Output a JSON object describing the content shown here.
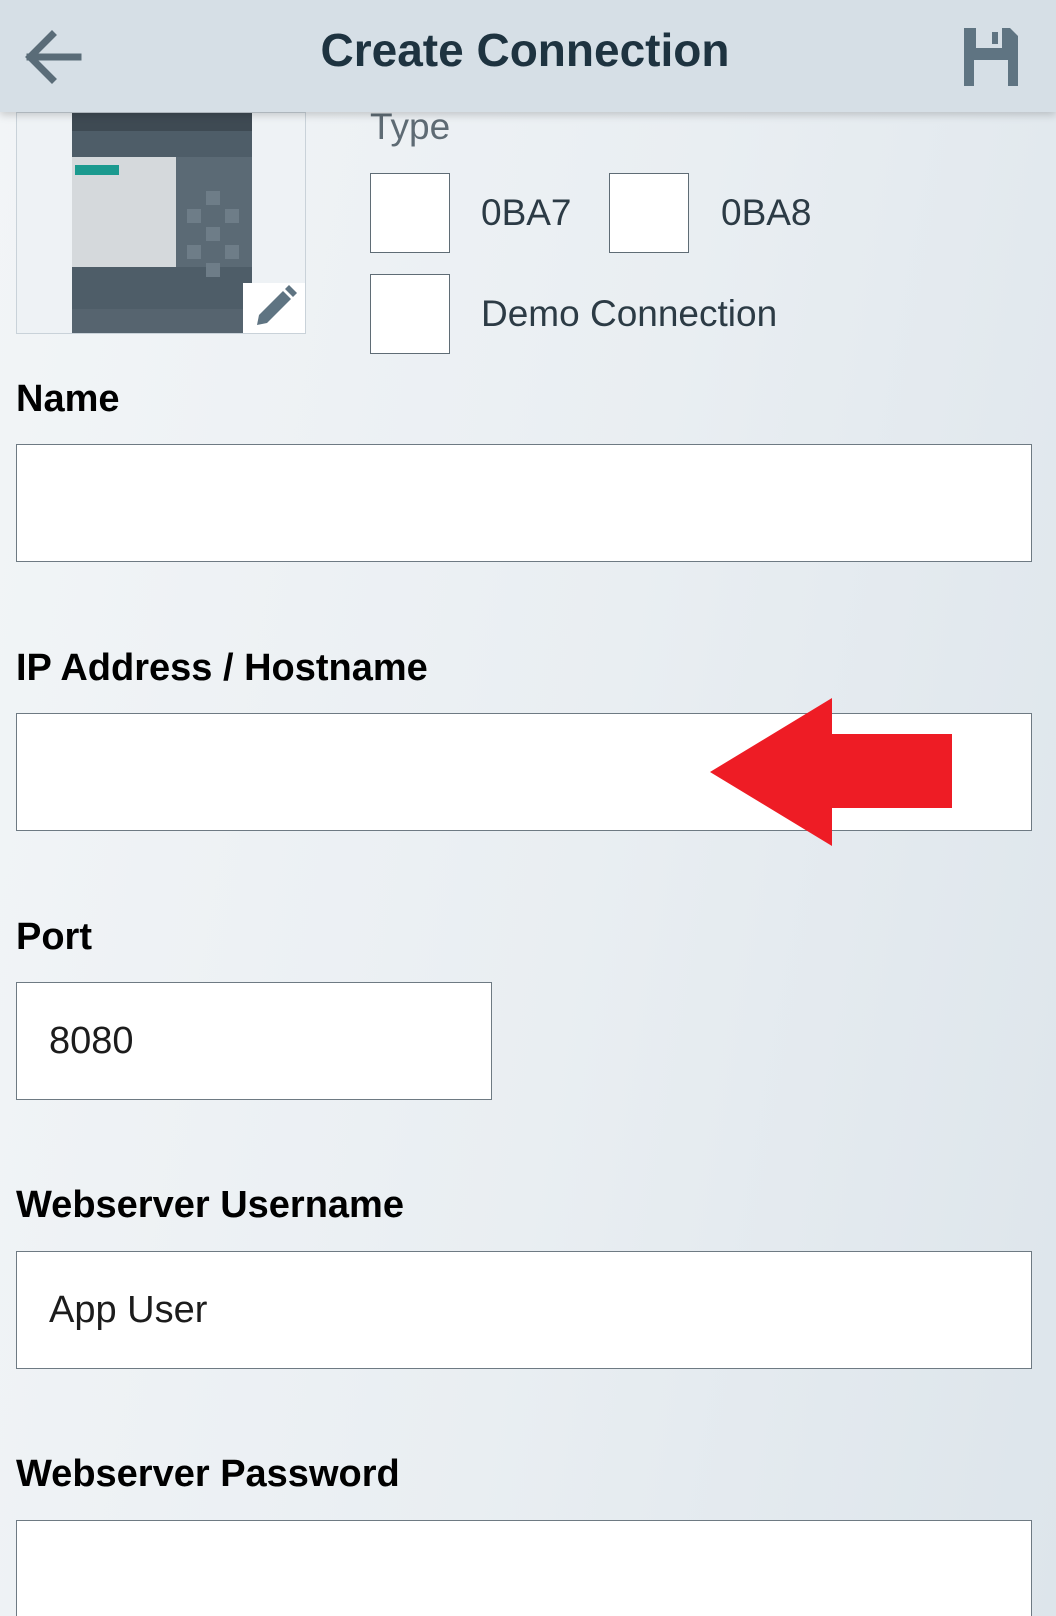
{
  "header": {
    "title": "Create Connection",
    "back_icon": "arrow-left-icon",
    "save_icon": "floppy-disk-icon"
  },
  "device": {
    "image": "logo-plc-device-image",
    "edit_icon": "pencil-icon"
  },
  "type_section": {
    "label": "Type",
    "options": [
      {
        "label": "0BA7",
        "checked": false
      },
      {
        "label": "0BA8",
        "checked": false
      },
      {
        "label": "Demo Connection",
        "checked": false
      }
    ]
  },
  "form": {
    "name": {
      "label": "Name",
      "value": ""
    },
    "ip": {
      "label": "IP Address / Hostname",
      "value": ""
    },
    "port": {
      "label": "Port",
      "value": "8080"
    },
    "username": {
      "label": "Webserver Username",
      "value": "App User"
    },
    "password": {
      "label": "Webserver Password",
      "value": ""
    }
  },
  "annotation": {
    "icon": "red-arrow-pointer",
    "color": "#ee1c25"
  },
  "colors": {
    "app_bar": "#d6dfe6",
    "title": "#1e3340",
    "accent_teal": "#1b9a8f"
  }
}
